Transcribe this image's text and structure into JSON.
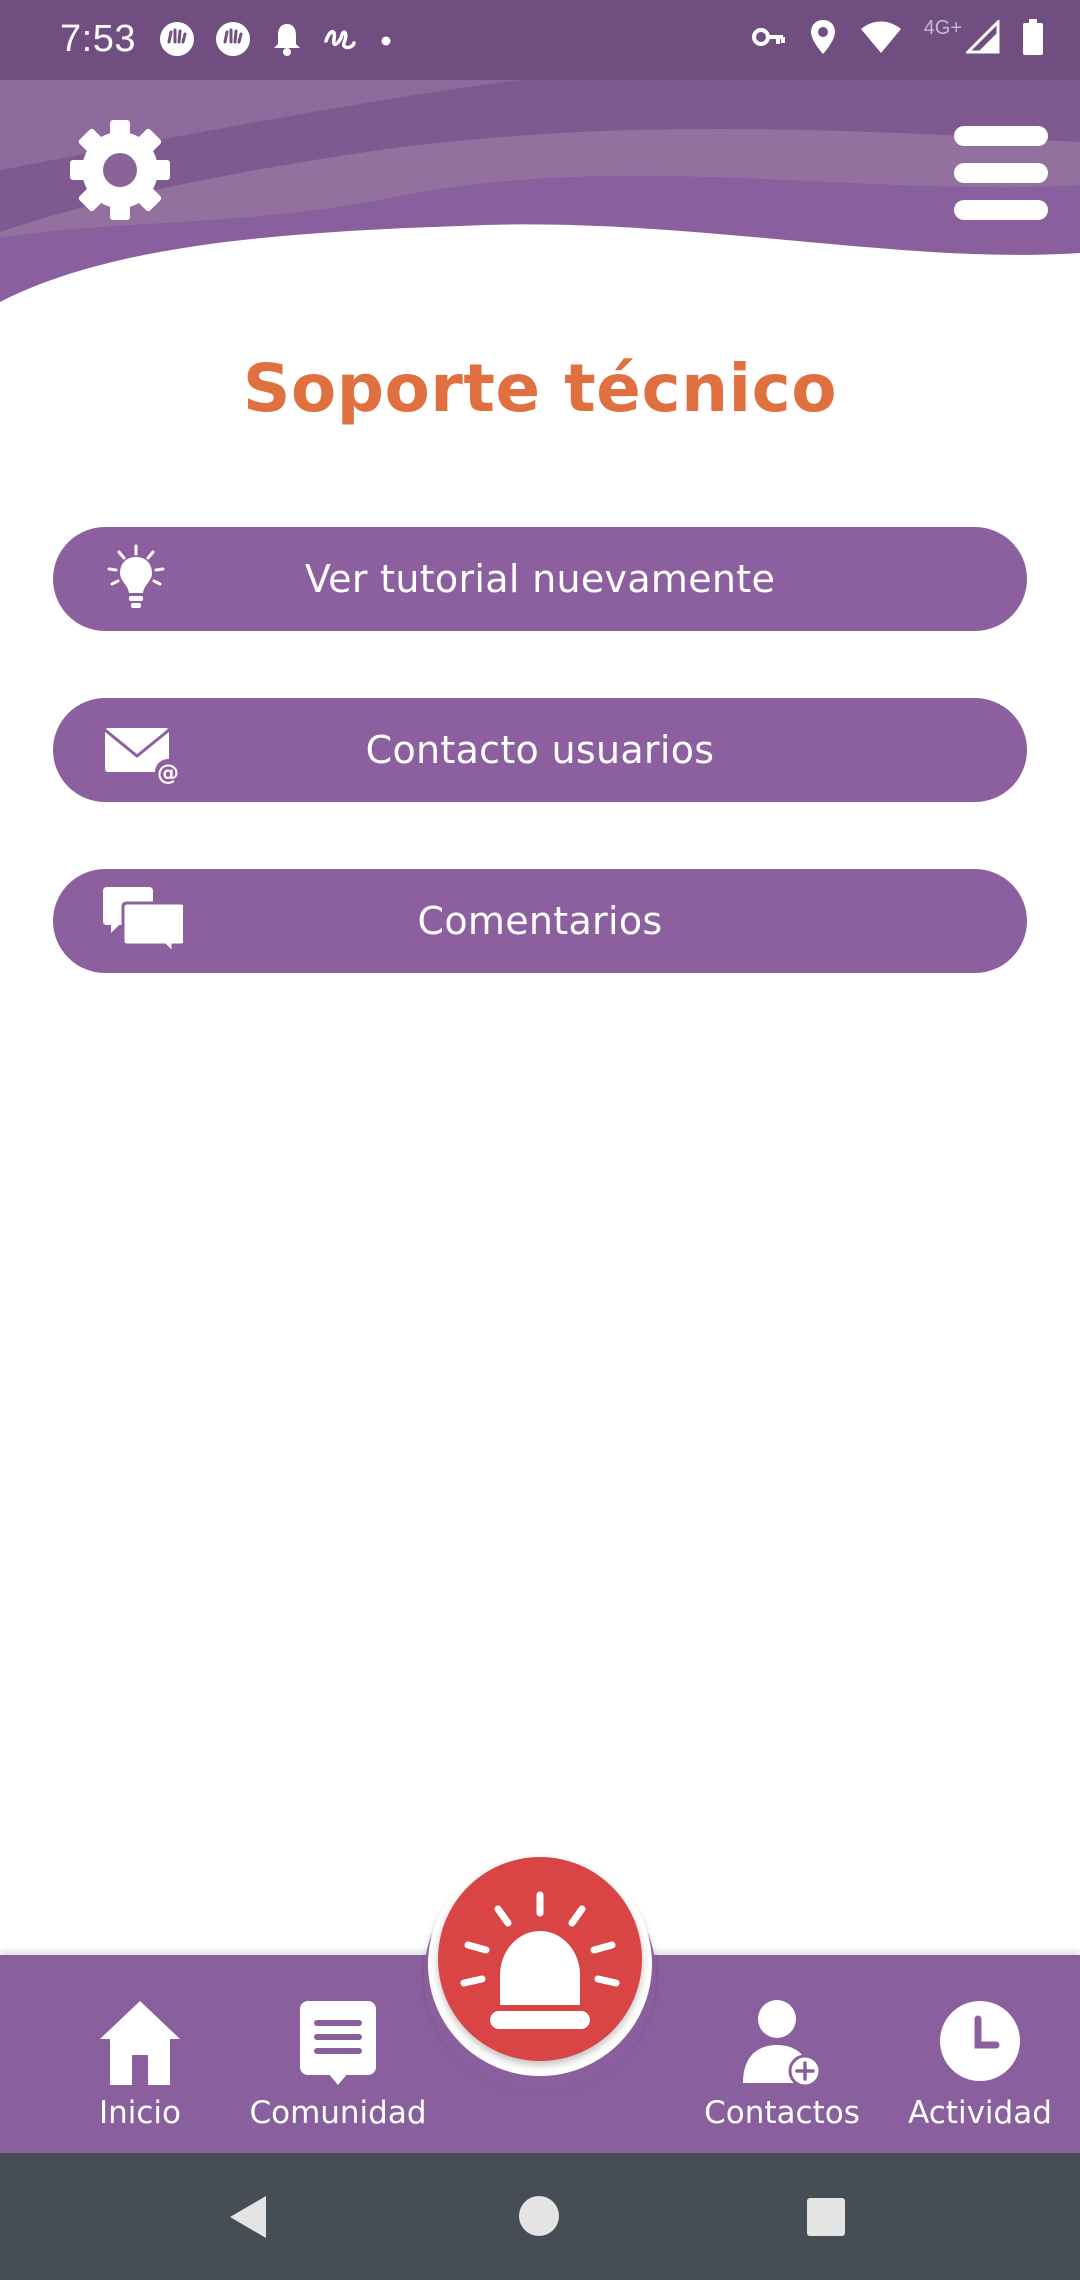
{
  "status_bar": {
    "time": "7:53",
    "network": "4G+"
  },
  "page": {
    "title": "Soporte técnico"
  },
  "options": [
    {
      "label": "Ver tutorial nuevamente",
      "icon": "lightbulb-icon"
    },
    {
      "label": "Contacto usuarios",
      "icon": "email-icon"
    },
    {
      "label": "Comentarios",
      "icon": "chat-bubbles-icon"
    }
  ],
  "bottom_nav": {
    "items": [
      {
        "label": "Inicio",
        "icon": "home-icon"
      },
      {
        "label": "Comunidad",
        "icon": "community-icon"
      },
      {
        "label": "Contactos",
        "icon": "add-contact-icon"
      },
      {
        "label": "Actividad",
        "icon": "clock-icon"
      }
    ],
    "center": {
      "icon": "alarm-siren-icon"
    }
  },
  "colors": {
    "status_bar": "#714e80",
    "primary": "#8c5f9e",
    "title": "#e0703f",
    "sos": "#d94545",
    "system_nav": "#474d54"
  }
}
